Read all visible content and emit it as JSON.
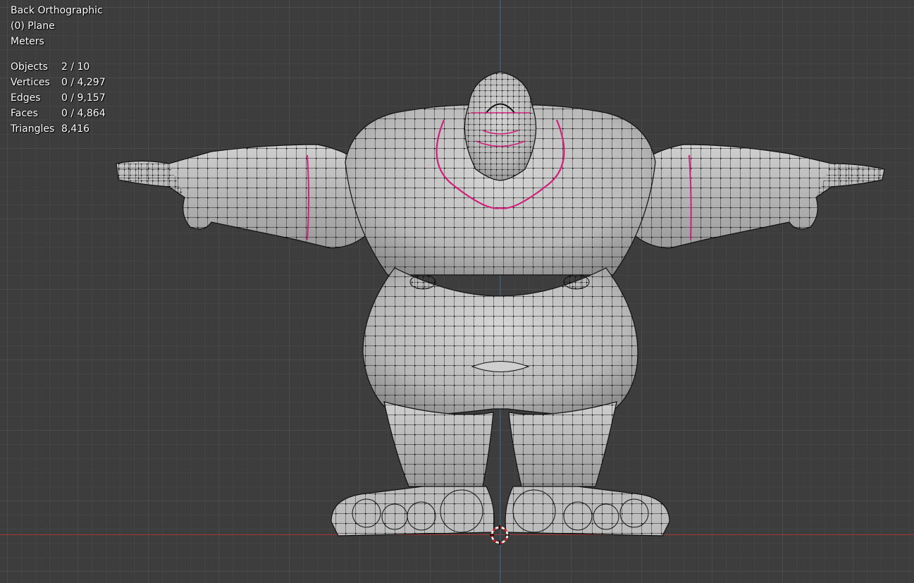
{
  "viewport": {
    "view_name": "Back Orthographic",
    "active_object": "(0) Plane",
    "units": "Meters"
  },
  "stats": [
    {
      "label": "Objects",
      "value": "2 / 10"
    },
    {
      "label": "Vertices",
      "value": "0 / 4,297"
    },
    {
      "label": "Edges",
      "value": "0 / 9,157"
    },
    {
      "label": "Faces",
      "value": "0 / 4,864"
    },
    {
      "label": "Triangles",
      "value": "8,416"
    }
  ],
  "colors": {
    "background": "#3d3d3d",
    "grid": "#4a4a4a",
    "x_axis": "#a33a3a",
    "z_axis": "#3a5c8f",
    "mesh_fill": "#c2c2c2",
    "wire": "#111111",
    "seam": "#d0207a"
  },
  "icons": {
    "cursor": "3d-cursor-icon"
  }
}
